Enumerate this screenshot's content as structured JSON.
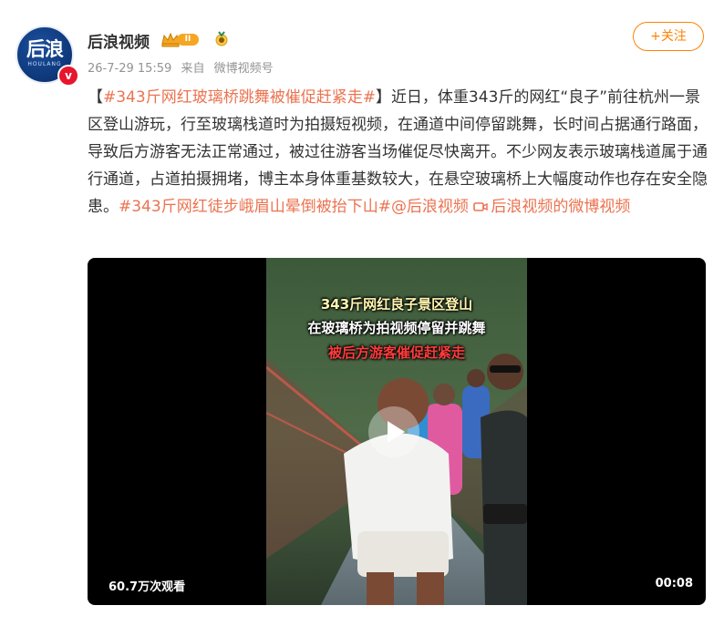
{
  "author": {
    "avatar_text": "后浪",
    "avatar_subtext": "HOULANG",
    "name": "后浪视频",
    "vip_level": "II",
    "verified_mark": "v"
  },
  "meta": {
    "time": "26-7-29 15:59",
    "source_prefix": "来自",
    "source": "微博视频号"
  },
  "follow_button": "+关注",
  "post": {
    "bracket_open": "【",
    "topic1": "#343斤网红玻璃桥跳舞被催促赶紧走#",
    "bracket_close": "】",
    "body": "近日，体重343斤的网红“良子”前往杭州一景区登山游玩，行至玻璃栈道时为拍摄短视频，在通道中间停留跳舞，长时间占据通行路面，导致后方游客无法正常通过，被过往游客当场催促尽快离开。不少网友表示玻璃栈道属于通行通道，占道拍摄拥堵，博主本身体重基数较大，在悬空玻璃桥上大幅度动作也存在安全隐患。",
    "topic2": "#343斤网红徒步峨眉山晕倒被抬下山#",
    "mention": "@后浪视频",
    "video_link": "后浪视频的微博视频"
  },
  "video": {
    "caption_line1": "343斤网红良子景区登山",
    "caption_line2": "在玻璃桥为拍视频停留并跳舞",
    "caption_line3": "被后方游客催促赶紧走",
    "view_count": "60.7万次观看",
    "duration": "00:08"
  },
  "colors": {
    "accent_orange": "#ff8200",
    "link_color": "#eb7350",
    "verified_red": "#e6162d",
    "meta_gray": "#939393"
  }
}
